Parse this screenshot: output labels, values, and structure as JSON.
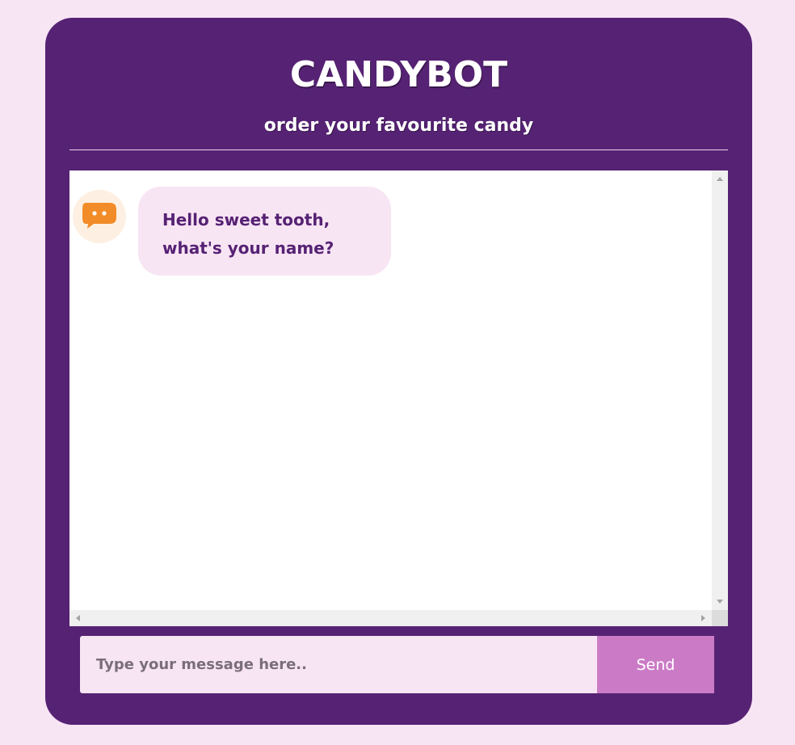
{
  "header": {
    "title": "CANDYBOT",
    "subtitle": "order your favourite candy"
  },
  "chat": {
    "messages": [
      {
        "sender": "bot",
        "avatar_icon": "chat-bubble-icon",
        "lines": [
          "Hello sweet tooth,",
          "what's your name?"
        ]
      }
    ]
  },
  "composer": {
    "placeholder": "Type your message here..",
    "value": "",
    "send_label": "Send"
  },
  "colors": {
    "page_background": "#f8e5f4",
    "card_background": "#562274",
    "bubble_background": "#f8e5f4",
    "send_button": "#cb7bc6",
    "avatar_icon": "#f28c28"
  }
}
